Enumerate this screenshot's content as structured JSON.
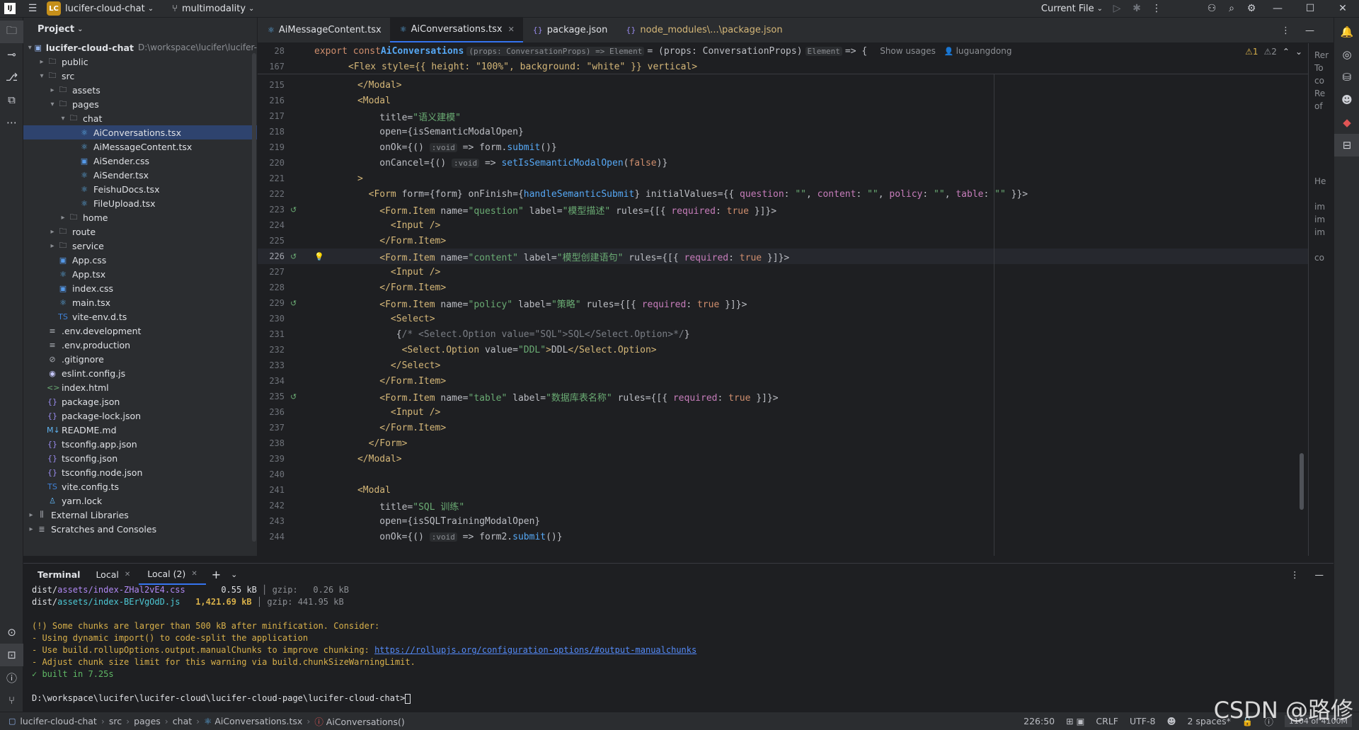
{
  "titlebar": {
    "project_badge": "LC",
    "project_name": "lucifer-cloud-chat",
    "branch": "multimodality",
    "run_config": "Current File"
  },
  "project_panel": {
    "title": "Project",
    "root_name": "lucifer-cloud-chat",
    "root_path": "D:\\workspace\\lucifer\\lucifer-",
    "tree": [
      {
        "label": "public",
        "depth": 1,
        "type": "folder",
        "arrow": "▸"
      },
      {
        "label": "src",
        "depth": 1,
        "type": "folder",
        "arrow": "▾"
      },
      {
        "label": "assets",
        "depth": 2,
        "type": "folder",
        "arrow": "▸"
      },
      {
        "label": "pages",
        "depth": 2,
        "type": "folder",
        "arrow": "▾"
      },
      {
        "label": "chat",
        "depth": 3,
        "type": "folder",
        "arrow": "▾"
      },
      {
        "label": "AiConversations.tsx",
        "depth": 4,
        "type": "react",
        "arrow": "",
        "selected": true
      },
      {
        "label": "AiMessageContent.tsx",
        "depth": 4,
        "type": "react",
        "arrow": ""
      },
      {
        "label": "AiSender.css",
        "depth": 4,
        "type": "css",
        "arrow": ""
      },
      {
        "label": "AiSender.tsx",
        "depth": 4,
        "type": "react",
        "arrow": ""
      },
      {
        "label": "FeishuDocs.tsx",
        "depth": 4,
        "type": "react",
        "arrow": ""
      },
      {
        "label": "FileUpload.tsx",
        "depth": 4,
        "type": "react",
        "arrow": ""
      },
      {
        "label": "home",
        "depth": 3,
        "type": "folder",
        "arrow": "▸"
      },
      {
        "label": "route",
        "depth": 2,
        "type": "folder",
        "arrow": "▸"
      },
      {
        "label": "service",
        "depth": 2,
        "type": "folder",
        "arrow": "▸"
      },
      {
        "label": "App.css",
        "depth": 2,
        "type": "css",
        "arrow": ""
      },
      {
        "label": "App.tsx",
        "depth": 2,
        "type": "react",
        "arrow": ""
      },
      {
        "label": "index.css",
        "depth": 2,
        "type": "css",
        "arrow": ""
      },
      {
        "label": "main.tsx",
        "depth": 2,
        "type": "react",
        "arrow": ""
      },
      {
        "label": "vite-env.d.ts",
        "depth": 2,
        "type": "ts",
        "arrow": ""
      },
      {
        "label": ".env.development",
        "depth": 1,
        "type": "text",
        "arrow": ""
      },
      {
        "label": ".env.production",
        "depth": 1,
        "type": "text",
        "arrow": ""
      },
      {
        "label": ".gitignore",
        "depth": 1,
        "type": "ignore",
        "arrow": ""
      },
      {
        "label": "eslint.config.js",
        "depth": 1,
        "type": "eslint",
        "arrow": ""
      },
      {
        "label": "index.html",
        "depth": 1,
        "type": "html",
        "arrow": ""
      },
      {
        "label": "package.json",
        "depth": 1,
        "type": "json",
        "arrow": ""
      },
      {
        "label": "package-lock.json",
        "depth": 1,
        "type": "json",
        "arrow": ""
      },
      {
        "label": "README.md",
        "depth": 1,
        "type": "md",
        "arrow": ""
      },
      {
        "label": "tsconfig.app.json",
        "depth": 1,
        "type": "json",
        "arrow": ""
      },
      {
        "label": "tsconfig.json",
        "depth": 1,
        "type": "json",
        "arrow": ""
      },
      {
        "label": "tsconfig.node.json",
        "depth": 1,
        "type": "json",
        "arrow": ""
      },
      {
        "label": "vite.config.ts",
        "depth": 1,
        "type": "ts",
        "arrow": ""
      },
      {
        "label": "yarn.lock",
        "depth": 1,
        "type": "yarn",
        "arrow": ""
      },
      {
        "label": "External Libraries",
        "depth": 0,
        "type": "lib",
        "arrow": "▸"
      },
      {
        "label": "Scratches and Consoles",
        "depth": 0,
        "type": "scratch",
        "arrow": "▸"
      }
    ]
  },
  "editor_tabs": [
    {
      "label": "AiMessageContent.tsx",
      "icon": "react",
      "active": false
    },
    {
      "label": "AiConversations.tsx",
      "icon": "react",
      "active": true
    },
    {
      "label": "package.json",
      "icon": "json",
      "active": false
    },
    {
      "label": "node_modules\\...\\package.json",
      "icon": "json",
      "active": false,
      "dim": true
    }
  ],
  "sticky": {
    "line1_no": "28",
    "line1_a": "export const ",
    "line1_name": "AiConversations",
    "line1_hint": "(props: ConversationProps) => Element",
    "line1_b": " = (props: ConversationProps)",
    "line1_hint2": "Element",
    "line1_c": " => {",
    "line1_usages": "Show usages",
    "line1_author": "luguangdong",
    "line2_no": "167",
    "line2_code": "<Flex style={{ height: \"100%\", background: \"white\" }} vertical>",
    "warn1": "⚠1",
    "warn2": "⚠2"
  },
  "code_lines": [
    {
      "no": "215",
      "indent": "      ",
      "html": [
        [
          "tag",
          "</Modal>"
        ]
      ]
    },
    {
      "no": "216",
      "indent": "      ",
      "html": [
        [
          "tag",
          "<Modal"
        ]
      ]
    },
    {
      "no": "217",
      "indent": "          ",
      "html": [
        [
          "attr",
          "title="
        ],
        [
          "str",
          "\"语义建模\""
        ]
      ]
    },
    {
      "no": "218",
      "indent": "          ",
      "html": [
        [
          "attr",
          "open={isSemanticModalOpen}"
        ]
      ]
    },
    {
      "no": "219",
      "indent": "          ",
      "html": [
        [
          "attr",
          "onOk={() "
        ],
        [
          "hint",
          ":void"
        ],
        [
          "attr",
          " => form."
        ],
        [
          "fn",
          "submit"
        ],
        [
          "attr",
          "()}"
        ]
      ]
    },
    {
      "no": "220",
      "indent": "          ",
      "html": [
        [
          "attr",
          "onCancel={() "
        ],
        [
          "hint",
          ":void"
        ],
        [
          "attr",
          " => "
        ],
        [
          "fn",
          "setIsSemanticModalOpen"
        ],
        [
          "attr",
          "("
        ],
        [
          "kw",
          "false"
        ],
        [
          "attr",
          ")}"
        ]
      ]
    },
    {
      "no": "221",
      "indent": "      ",
      "html": [
        [
          "tag",
          ">"
        ]
      ]
    },
    {
      "no": "222",
      "indent": "        ",
      "html": [
        [
          "tag",
          "<Form "
        ],
        [
          "attr",
          "form={form} onFinish={"
        ],
        [
          "fn",
          "handleSemanticSubmit"
        ],
        [
          "attr",
          "} initialValues={{ "
        ],
        [
          "prop",
          "question"
        ],
        [
          "attr",
          ": "
        ],
        [
          "str",
          "\"\""
        ],
        [
          "attr",
          ", "
        ],
        [
          "prop",
          "content"
        ],
        [
          "attr",
          ": "
        ],
        [
          "str",
          "\"\""
        ],
        [
          "attr",
          ", "
        ],
        [
          "prop",
          "policy"
        ],
        [
          "attr",
          ": "
        ],
        [
          "str",
          "\"\""
        ],
        [
          "attr",
          ", "
        ],
        [
          "prop",
          "table"
        ],
        [
          "attr",
          ": "
        ],
        [
          "str",
          "\"\""
        ],
        [
          "attr",
          " }}>"
        ]
      ]
    },
    {
      "no": "223",
      "indent": "          ",
      "gutter": "git",
      "html": [
        [
          "tag",
          "<Form.Item "
        ],
        [
          "attr",
          "name="
        ],
        [
          "str",
          "\"question\""
        ],
        [
          "attr",
          " label="
        ],
        [
          "str",
          "\"模型描述\""
        ],
        [
          "attr",
          " rules={[{ "
        ],
        [
          "prop",
          "required"
        ],
        [
          "attr",
          ": "
        ],
        [
          "kw",
          "true"
        ],
        [
          "attr",
          " }]}>"
        ]
      ]
    },
    {
      "no": "224",
      "indent": "            ",
      "html": [
        [
          "tag",
          "<Input />"
        ]
      ]
    },
    {
      "no": "225",
      "indent": "          ",
      "html": [
        [
          "tag",
          "</Form.Item>"
        ]
      ]
    },
    {
      "no": "226",
      "indent": "          ",
      "gutter": "git",
      "bulb": true,
      "current": true,
      "html": [
        [
          "tag",
          "<Form.Item "
        ],
        [
          "attr",
          "name="
        ],
        [
          "str",
          "\"content\""
        ],
        [
          "attr",
          " label="
        ],
        [
          "str",
          "\"模型创建语句\""
        ],
        [
          "attr",
          " rules={[{ "
        ],
        [
          "prop",
          "required"
        ],
        [
          "attr",
          ": "
        ],
        [
          "kw",
          "true"
        ],
        [
          "attr",
          " }]}>"
        ]
      ]
    },
    {
      "no": "227",
      "indent": "            ",
      "html": [
        [
          "tag",
          "<Input />"
        ]
      ]
    },
    {
      "no": "228",
      "indent": "          ",
      "html": [
        [
          "tag",
          "</Form.Item>"
        ]
      ]
    },
    {
      "no": "229",
      "indent": "          ",
      "gutter": "git",
      "html": [
        [
          "tag",
          "<Form.Item "
        ],
        [
          "attr",
          "name="
        ],
        [
          "str",
          "\"policy\""
        ],
        [
          "attr",
          " label="
        ],
        [
          "str",
          "\"策略\""
        ],
        [
          "attr",
          " rules={[{ "
        ],
        [
          "prop",
          "required"
        ],
        [
          "attr",
          ": "
        ],
        [
          "kw",
          "true"
        ],
        [
          "attr",
          " }]}>"
        ]
      ]
    },
    {
      "no": "230",
      "indent": "            ",
      "html": [
        [
          "tag",
          "<Select>"
        ]
      ]
    },
    {
      "no": "231",
      "indent": "             ",
      "html": [
        [
          "attr",
          "{"
        ],
        [
          "cmt",
          "/* <Select.Option value=\"SQL\">SQL</Select.Option>*/"
        ],
        [
          "attr",
          "}"
        ]
      ]
    },
    {
      "no": "232",
      "indent": "              ",
      "html": [
        [
          "tag",
          "<Select.Option "
        ],
        [
          "attr",
          "value="
        ],
        [
          "str",
          "\"DDL\""
        ],
        [
          "tag",
          ">"
        ],
        [
          "attr",
          "DDL"
        ],
        [
          "tag",
          "</Select.Option>"
        ]
      ]
    },
    {
      "no": "233",
      "indent": "            ",
      "html": [
        [
          "tag",
          "</Select>"
        ]
      ]
    },
    {
      "no": "234",
      "indent": "          ",
      "html": [
        [
          "tag",
          "</Form.Item>"
        ]
      ]
    },
    {
      "no": "235",
      "indent": "          ",
      "gutter": "git",
      "html": [
        [
          "tag",
          "<Form.Item "
        ],
        [
          "attr",
          "name="
        ],
        [
          "str",
          "\"table\""
        ],
        [
          "attr",
          " label="
        ],
        [
          "str",
          "\"数据库表名称\""
        ],
        [
          "attr",
          " rules={[{ "
        ],
        [
          "prop",
          "required"
        ],
        [
          "attr",
          ": "
        ],
        [
          "kw",
          "true"
        ],
        [
          "attr",
          " }]}>"
        ]
      ]
    },
    {
      "no": "236",
      "indent": "            ",
      "html": [
        [
          "tag",
          "<Input />"
        ]
      ]
    },
    {
      "no": "237",
      "indent": "          ",
      "html": [
        [
          "tag",
          "</Form.Item>"
        ]
      ]
    },
    {
      "no": "238",
      "indent": "        ",
      "html": [
        [
          "tag",
          "</Form>"
        ]
      ]
    },
    {
      "no": "239",
      "indent": "      ",
      "html": [
        [
          "tag",
          "</Modal>"
        ]
      ]
    },
    {
      "no": "240",
      "indent": "",
      "html": []
    },
    {
      "no": "241",
      "indent": "      ",
      "html": [
        [
          "tag",
          "<Modal"
        ]
      ]
    },
    {
      "no": "242",
      "indent": "          ",
      "html": [
        [
          "attr",
          "title="
        ],
        [
          "str",
          "\"SQL 训练\""
        ]
      ]
    },
    {
      "no": "243",
      "indent": "          ",
      "html": [
        [
          "attr",
          "open={isSQLTrainingModalOpen}"
        ]
      ]
    },
    {
      "no": "244",
      "indent": "          ",
      "html": [
        [
          "attr",
          "onOk={() "
        ],
        [
          "hint",
          ":void"
        ],
        [
          "attr",
          " => form2."
        ],
        [
          "fn",
          "submit"
        ],
        [
          "attr",
          "()}"
        ]
      ]
    }
  ],
  "terminal": {
    "title": "Terminal",
    "tabs": [
      {
        "label": "Local",
        "active": false
      },
      {
        "label": "Local (2)",
        "active": true
      }
    ],
    "lines": [
      [
        [
          "t-default",
          "dist/"
        ],
        [
          "t-asset",
          "assets/index-ZHal2vE4.css"
        ],
        [
          "t-default",
          "       0.55 kB "
        ],
        [
          "t-dim",
          "│ gzip:   0.26 kB"
        ]
      ],
      [
        [
          "t-default",
          "dist/"
        ],
        [
          "t-js",
          "assets/index-BErVgOdD.js"
        ],
        [
          "t-size",
          "   1,421.69 kB "
        ],
        [
          "t-dim",
          "│ gzip: 441.95 kB"
        ]
      ],
      [],
      [
        [
          "t-warn",
          "(!) Some chunks are larger than 500 kB after minification. Consider:"
        ]
      ],
      [
        [
          "t-warn",
          "- Using dynamic import() to code-split the application"
        ]
      ],
      [
        [
          "t-warn",
          "- Use build.rollupOptions.output.manualChunks to improve chunking: "
        ],
        [
          "t-link",
          "https://rollupjs.org/configuration-options/#output-manualchunks"
        ]
      ],
      [
        [
          "t-warn",
          "- Adjust chunk size limit for this warning via build.chunkSizeWarningLimit."
        ]
      ],
      [
        [
          "t-ok",
          "✓ built in 7.25s"
        ]
      ],
      [],
      [
        [
          "t-default",
          "D:\\workspace\\lucifer\\lucifer-cloud\\lucifer-cloud-page\\lucifer-cloud-chat>"
        ]
      ]
    ]
  },
  "statusbar": {
    "crumbs": [
      "lucifer-cloud-chat",
      "src",
      "pages",
      "chat",
      "AiConversations.tsx",
      "AiConversations()"
    ],
    "position": "226:50",
    "line_sep": "CRLF",
    "encoding": "UTF-8",
    "indent": "2 spaces*",
    "memory": "1104 of 4100M"
  },
  "right_partial": {
    "lines": [
      "Rer",
      "To",
      "co",
      "Re",
      "of",
      "He",
      "im",
      "im",
      "im",
      "co"
    ]
  },
  "watermark": "CSDN @路修"
}
